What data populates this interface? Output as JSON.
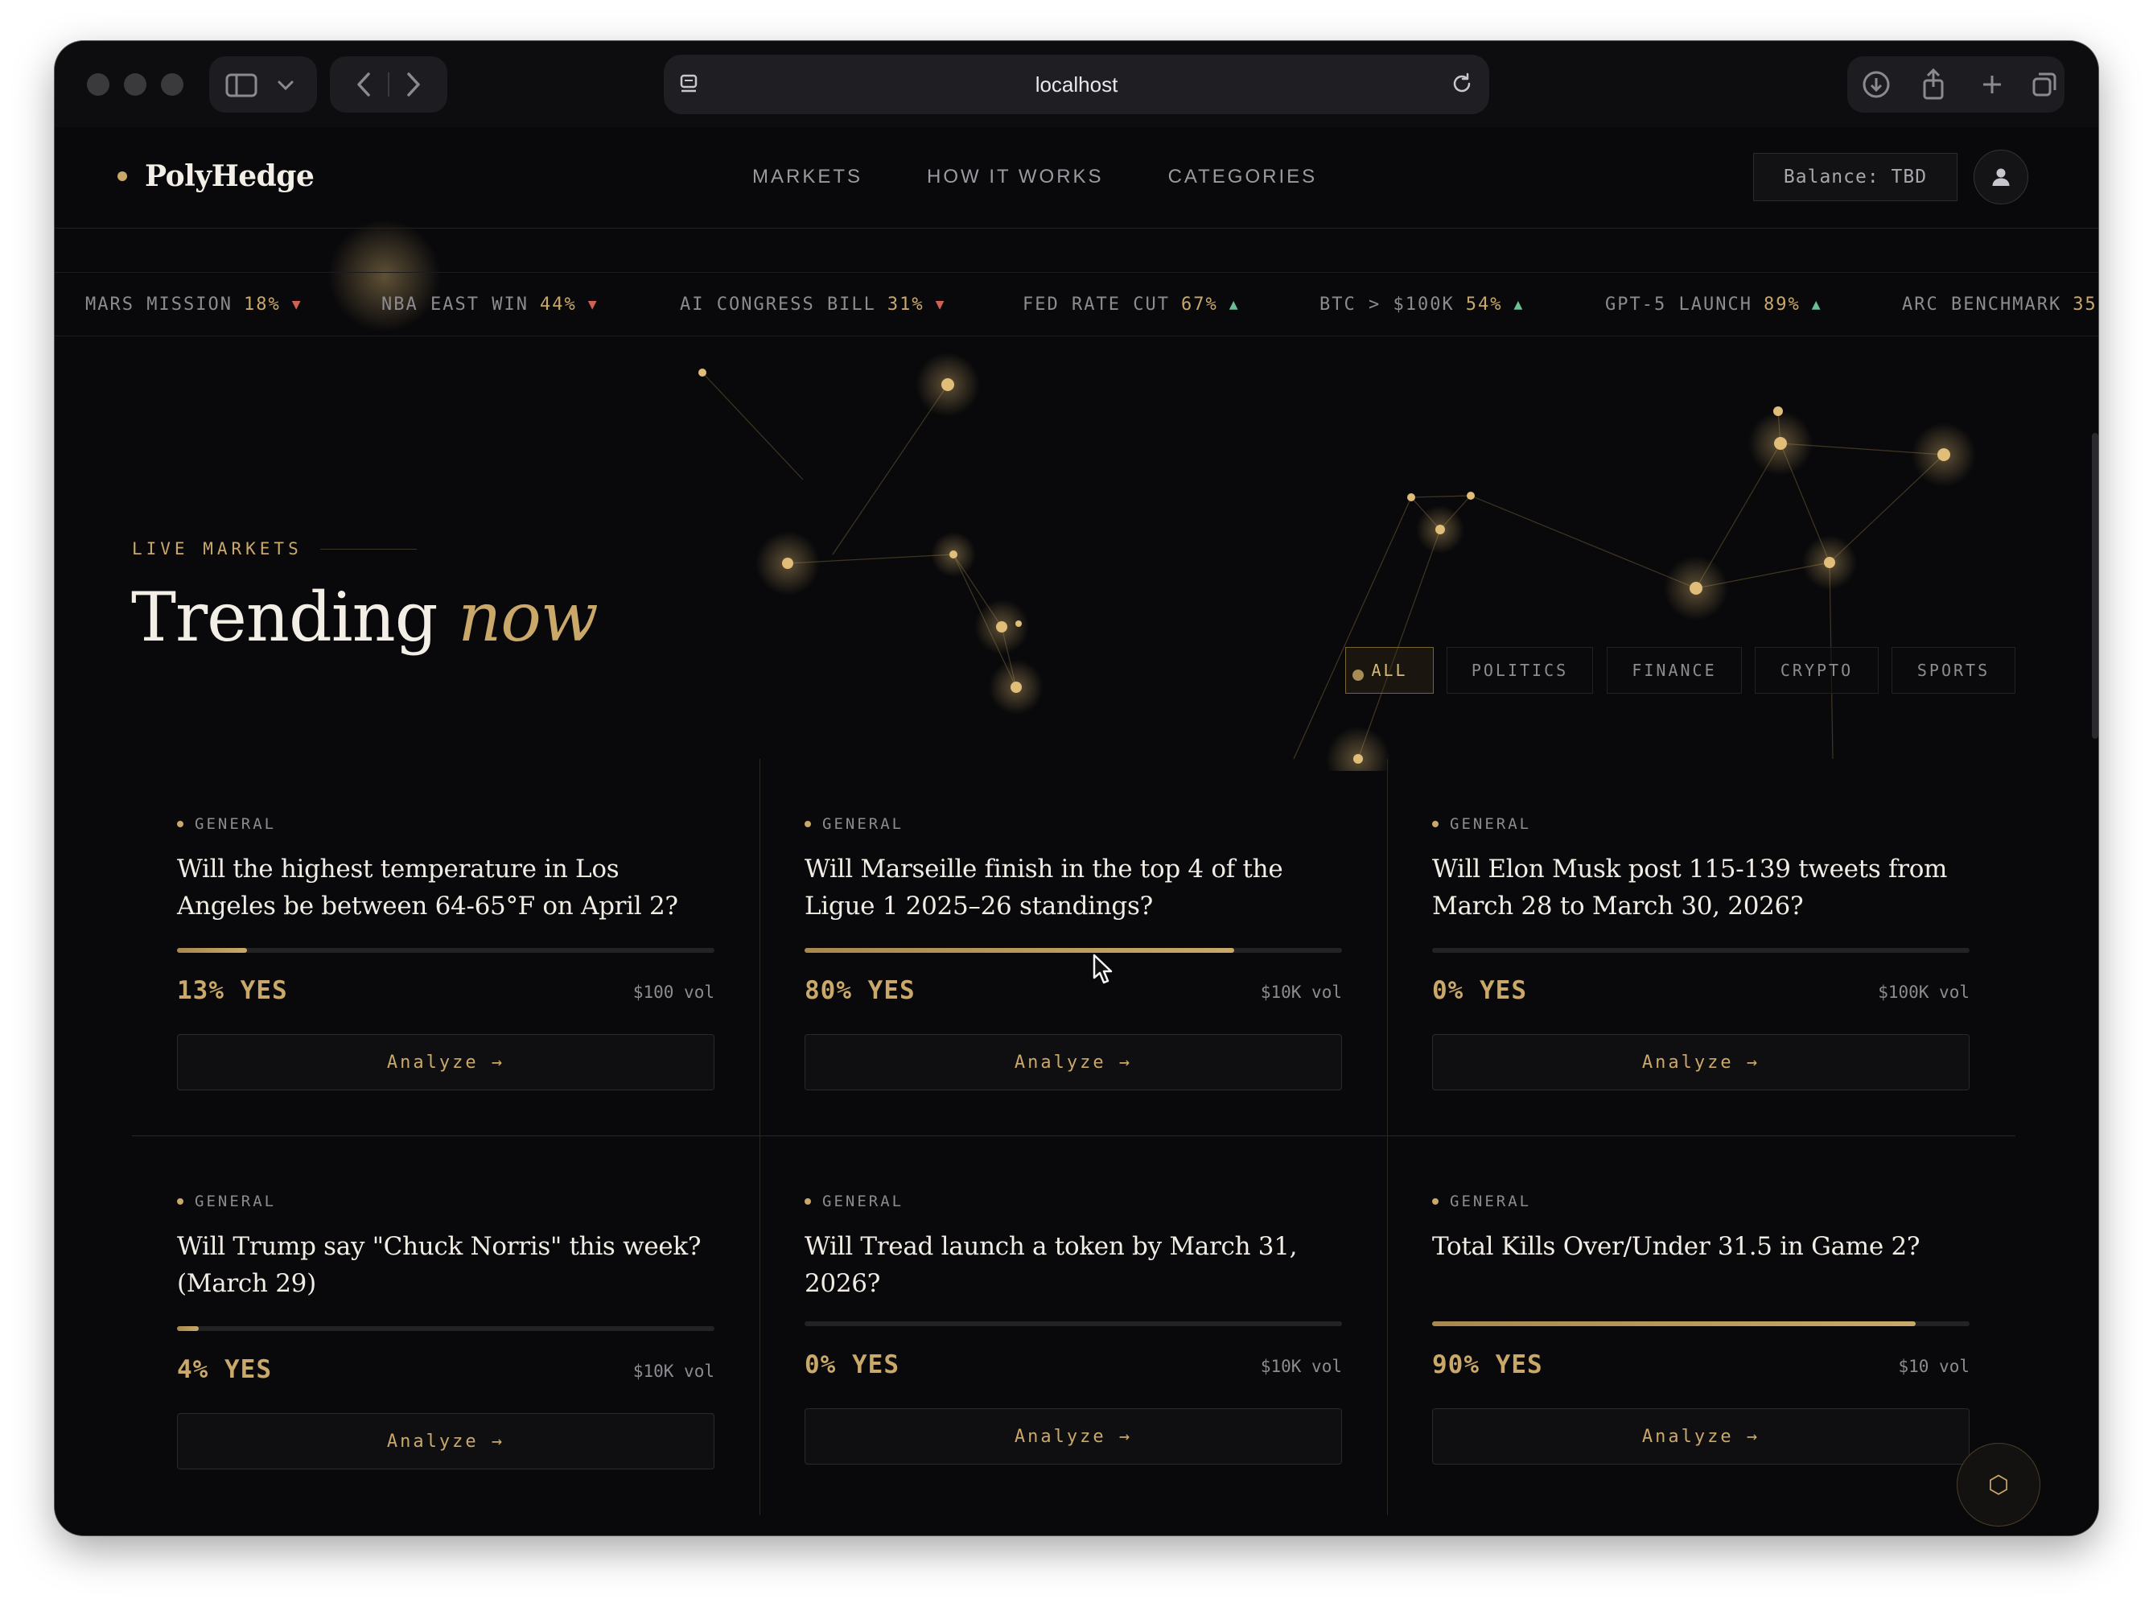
{
  "browser": {
    "url": "localhost"
  },
  "nav": {
    "brand": "PolyHedge",
    "links": [
      "MARKETS",
      "HOW IT WORKS",
      "CATEGORIES"
    ],
    "balance": "Balance: TBD"
  },
  "ticker": [
    {
      "name": "MARS MISSION",
      "pct": "18%",
      "dir": "▼"
    },
    {
      "name": "NBA EAST WIN",
      "pct": "44%",
      "dir": "▼"
    },
    {
      "name": "AI CONGRESS BILL",
      "pct": "31%",
      "dir": "▼"
    },
    {
      "name": "FED RATE CUT",
      "pct": "67%",
      "dir": "▲"
    },
    {
      "name": "BTC > $100K",
      "pct": "54%",
      "dir": "▲"
    },
    {
      "name": "GPT-5 LAUNCH",
      "pct": "89%",
      "dir": "▲"
    },
    {
      "name": "ARC BENCHMARK",
      "pct": "35",
      "dir": ""
    }
  ],
  "section": {
    "label": "LIVE MARKETS",
    "title": "Trending",
    "title_em": "now"
  },
  "filters": [
    "ALL",
    "POLITICS",
    "FINANCE",
    "CRYPTO",
    "SPORTS"
  ],
  "filter_active": "ALL",
  "cards": [
    {
      "category": "GENERAL",
      "question": "Will the highest temperature in Los Angeles be between 64-65°F on April 2?",
      "probability": 0.13,
      "odds": "13% YES",
      "volume": "$100 vol",
      "action": "Analyze →"
    },
    {
      "category": "GENERAL",
      "question": "Will Marseille finish in the top 4 of the Ligue 1 2025–26 standings?",
      "probability": 0.8,
      "odds": "80% YES",
      "volume": "$10K vol",
      "action": "Analyze →"
    },
    {
      "category": "GENERAL",
      "question": "Will Elon Musk post 115-139 tweets from March 28 to March 30, 2026?",
      "probability": 0.0,
      "odds": "0% YES",
      "volume": "$100K vol",
      "action": "Analyze →"
    },
    {
      "category": "GENERAL",
      "question": "Will Trump say \"Chuck Norris\" this week? (March 29)",
      "probability": 0.04,
      "odds": "4% YES",
      "volume": "$10K vol",
      "action": "Analyze →"
    },
    {
      "category": "GENERAL",
      "question": "Will Tread launch a token by March 31, 2026?",
      "probability": 0.0,
      "odds": "0% YES",
      "volume": "$10K vol",
      "action": "Analyze →"
    },
    {
      "category": "GENERAL",
      "question": "Total Kills Over/Under 31.5 in Game 2?",
      "probability": 0.9,
      "odds": "90% YES",
      "volume": "$10 vol",
      "action": "Analyze →"
    }
  ],
  "fab_icon": "⬡",
  "colors": {
    "accent": "#c9a86a",
    "background": "#09090b",
    "down": "#d06055",
    "up": "#6bbf93"
  }
}
